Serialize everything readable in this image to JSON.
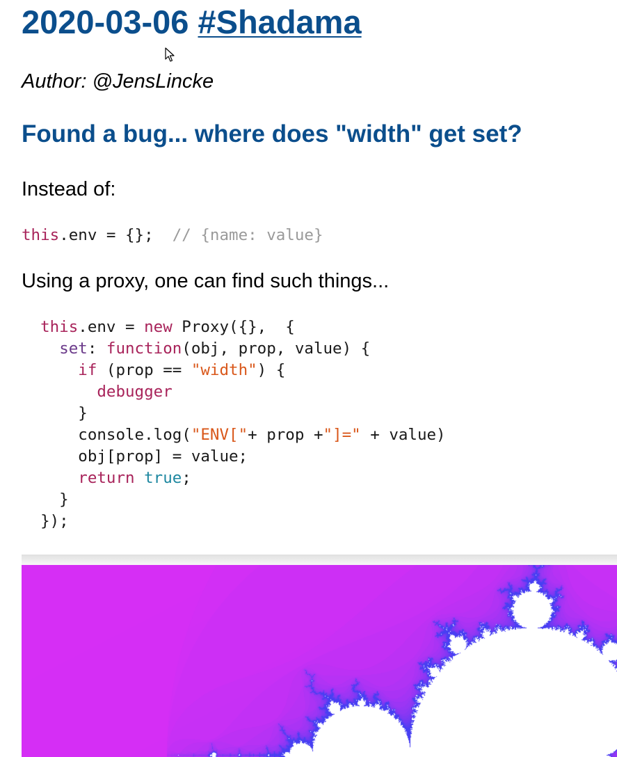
{
  "header": {
    "date": "2020-03-06",
    "tag_link": "#Shadama"
  },
  "author": "Author: @JensLincke",
  "section_heading": "Found a bug... where does \"width\" get set?",
  "paragraphs": {
    "intro": "Instead of:",
    "proxy_intro": "Using a proxy, one can find such things..."
  },
  "code_inline": [
    [
      [
        "kw",
        "this"
      ],
      [
        "plain",
        ".env = {};  "
      ],
      [
        "com",
        "// {name: value}"
      ]
    ]
  ],
  "code_block": [
    [
      [
        "plain",
        "  "
      ],
      [
        "kw",
        "this"
      ],
      [
        "plain",
        ".env = "
      ],
      [
        "kw",
        "new"
      ],
      [
        "plain",
        " Proxy({},  {"
      ]
    ],
    [
      [
        "plain",
        "    "
      ],
      [
        "prop",
        "set"
      ],
      [
        "plain",
        ": "
      ],
      [
        "kw",
        "function"
      ],
      [
        "plain",
        "(obj, prop, value) {"
      ]
    ],
    [
      [
        "plain",
        "      "
      ],
      [
        "kw",
        "if"
      ],
      [
        "plain",
        " (prop == "
      ],
      [
        "str",
        "\"width\""
      ],
      [
        "plain",
        ") {"
      ]
    ],
    [
      [
        "plain",
        "        "
      ],
      [
        "kw",
        "debugger"
      ]
    ],
    [
      [
        "plain",
        "      }"
      ]
    ],
    [
      [
        "plain",
        "      console.log("
      ],
      [
        "str",
        "\"ENV[\""
      ],
      [
        "plain",
        "+ prop +"
      ],
      [
        "str",
        "\"]=\""
      ],
      [
        "plain",
        " + value)"
      ]
    ],
    [
      [
        "plain",
        "      obj[prop] = value;"
      ]
    ],
    [
      [
        "plain",
        "      "
      ],
      [
        "kw",
        "return"
      ],
      [
        "plain",
        " "
      ],
      [
        "atom",
        "true"
      ],
      [
        "plain",
        ";"
      ]
    ],
    [
      [
        "plain",
        "    }"
      ]
    ],
    [
      [
        "plain",
        "  });"
      ]
    ]
  ],
  "colors": {
    "heading": "#0b4e8c",
    "keyword": "#a8235a",
    "property": "#6b3a8a",
    "string": "#d9571a",
    "atom": "#1d87a0",
    "comment": "#9a9a9a",
    "fractal_background": "#d92ef5",
    "fractal_edge": "#4a3ff2",
    "fractal_set": "#ffffff"
  },
  "icons": {
    "cursor": "mouse-pointer-icon"
  },
  "fractal": {
    "description_kind": "mandelbrot-render"
  }
}
